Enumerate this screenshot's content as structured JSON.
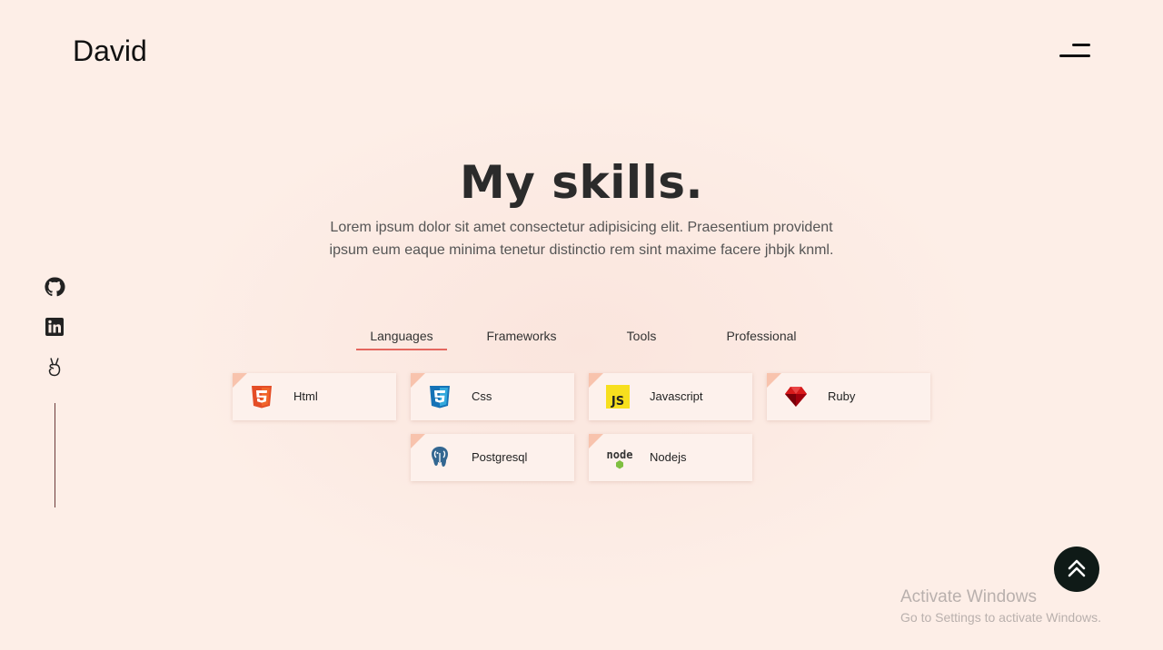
{
  "header": {
    "logo": "David"
  },
  "social": {
    "items": [
      {
        "icon": "github-icon"
      },
      {
        "icon": "linkedin-icon"
      },
      {
        "icon": "angellist-icon"
      }
    ]
  },
  "hero": {
    "title": "My skills.",
    "description": "Lorem ipsum dolor sit amet consectetur adipisicing elit. Praesentium provident ipsum eum eaque minima tenetur distinctio rem sint maxime facere jhbjk knml."
  },
  "tabs": [
    {
      "label": "Languages",
      "active": true
    },
    {
      "label": "Frameworks",
      "active": false
    },
    {
      "label": "Tools",
      "active": false
    },
    {
      "label": "Professional",
      "active": false
    }
  ],
  "skills": [
    {
      "label": "Html",
      "icon": "html5-icon"
    },
    {
      "label": "Css",
      "icon": "css3-icon"
    },
    {
      "label": "Javascript",
      "icon": "javascript-icon"
    },
    {
      "label": "Ruby",
      "icon": "ruby-icon"
    },
    {
      "label": "Postgresql",
      "icon": "postgresql-icon"
    },
    {
      "label": "Nodejs",
      "icon": "nodejs-icon"
    }
  ],
  "watermark": {
    "line1": "Activate Windows",
    "line2": "Go to Settings to activate Windows."
  },
  "colors": {
    "accent": "#e4665e",
    "background": "#fdeee7",
    "dark": "#0f1a17"
  }
}
